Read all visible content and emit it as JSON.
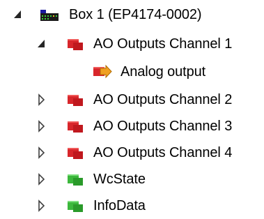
{
  "tree": {
    "root": {
      "label": "Box 1 (EP4174-0002)",
      "expanded": true,
      "icon": "box-device-icon"
    },
    "channel1": {
      "label": "AO Outputs Channel 1",
      "expanded": true,
      "icon": "red-module-icon",
      "child": {
        "label": "Analog output",
        "icon": "analog-output-arrow-icon"
      }
    },
    "channel2": {
      "label": "AO Outputs Channel 2",
      "expanded": false,
      "icon": "red-module-icon"
    },
    "channel3": {
      "label": "AO Outputs Channel 3",
      "expanded": false,
      "icon": "red-module-icon"
    },
    "channel4": {
      "label": "AO Outputs Channel 4",
      "expanded": false,
      "icon": "red-module-icon"
    },
    "wcstate": {
      "label": "WcState",
      "expanded": false,
      "icon": "green-module-icon"
    },
    "infodata": {
      "label": "InfoData",
      "expanded": false,
      "icon": "green-module-icon"
    }
  },
  "colors": {
    "expanded_arrow": "#262626",
    "collapsed_arrow": "#404040",
    "red_module": "#d8262b",
    "green_module": "#3cb83c",
    "output_arrow": "#f0a020"
  }
}
